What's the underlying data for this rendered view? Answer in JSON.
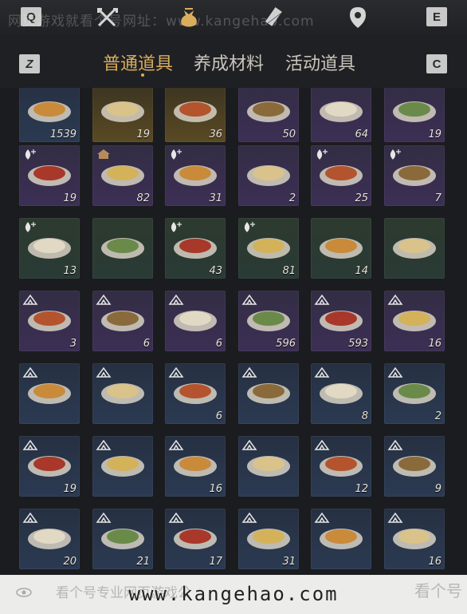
{
  "topbar": {
    "left_key": "Q",
    "right_key": "E",
    "watermark": "网页游戏就看个号网址：www.kangehao.com",
    "icons": [
      "crossed-swords-icon",
      "money-bag-icon",
      "scroll-icon",
      "location-pin-icon"
    ]
  },
  "tabs": {
    "left_key": "Z",
    "right_key": "C",
    "items": [
      "普通道具",
      "养成材料",
      "活动道具"
    ],
    "active_index": 0
  },
  "items": [
    {
      "count": "1539",
      "bg": "navy",
      "icon": "jade-tablet-icon",
      "badge": ""
    },
    {
      "count": "19",
      "bg": "gold",
      "icon": "censer-icon",
      "badge": ""
    },
    {
      "count": "36",
      "bg": "gold",
      "icon": "gold-ingot-icon",
      "badge": ""
    },
    {
      "count": "50",
      "bg": "purple",
      "icon": "jade-stone-icon",
      "badge": ""
    },
    {
      "count": "64",
      "bg": "purple",
      "icon": "steamed-buns-icon",
      "badge": ""
    },
    {
      "count": "19",
      "bg": "purple",
      "icon": "porridge-bowl-icon",
      "badge": ""
    },
    {
      "count": "19",
      "bg": "purple",
      "icon": "egg-soup-icon",
      "badge": "drop-plus-icon"
    },
    {
      "count": "82",
      "bg": "purple",
      "icon": "stir-fry-icon",
      "badge": "house-icon"
    },
    {
      "count": "31",
      "bg": "purple",
      "icon": "fish-plate-icon",
      "badge": "drop-plus-icon"
    },
    {
      "count": "2",
      "bg": "purple",
      "icon": "wine-jar-icon",
      "badge": ""
    },
    {
      "count": "25",
      "bg": "purple",
      "icon": "egg-plate-icon",
      "badge": "drop-plus-icon"
    },
    {
      "count": "7",
      "bg": "purple",
      "icon": "meat-plate-icon",
      "badge": "drop-plus-icon"
    },
    {
      "count": "13",
      "bg": "green",
      "icon": "okra-plate-icon",
      "badge": "drop-plus-icon"
    },
    {
      "count": "",
      "bg": "green",
      "icon": "ribs-icon",
      "badge": ""
    },
    {
      "count": "43",
      "bg": "green",
      "icon": "mushroom-bowl-icon",
      "badge": "drop-plus-icon"
    },
    {
      "count": "81",
      "bg": "green",
      "icon": "stew-pot-icon",
      "badge": "drop-plus-icon"
    },
    {
      "count": "14",
      "bg": "green",
      "icon": "braised-bowl-icon",
      "badge": ""
    },
    {
      "count": "",
      "bg": "green",
      "icon": "meatball-plate-icon",
      "badge": ""
    },
    {
      "count": "3",
      "bg": "purple",
      "icon": "braised-meat-icon",
      "badge": "tent-icon"
    },
    {
      "count": "6",
      "bg": "purple",
      "icon": "fried-rice-icon",
      "badge": "tent-icon"
    },
    {
      "count": "6",
      "bg": "purple",
      "icon": "roast-leg-icon",
      "badge": "tent-icon"
    },
    {
      "count": "596",
      "bg": "purple",
      "icon": "stew-bowl-icon",
      "badge": "tent-icon"
    },
    {
      "count": "593",
      "bg": "purple",
      "icon": "bun-basket-icon",
      "badge": "tent-icon"
    },
    {
      "count": "16",
      "bg": "purple",
      "icon": "grilled-meat-icon",
      "badge": "tent-icon"
    },
    {
      "count": "",
      "bg": "navy",
      "icon": "sliced-pork-icon",
      "badge": "tent-icon"
    },
    {
      "count": "",
      "bg": "navy",
      "icon": "dumplings-icon",
      "badge": "tent-icon"
    },
    {
      "count": "6",
      "bg": "navy",
      "icon": "cake-icon",
      "badge": "tent-icon"
    },
    {
      "count": "",
      "bg": "navy",
      "icon": "pancake-icon",
      "badge": "tent-icon"
    },
    {
      "count": "8",
      "bg": "navy",
      "icon": "veg-soup-icon",
      "badge": "tent-icon"
    },
    {
      "count": "2",
      "bg": "navy",
      "icon": "greens-bowl-icon",
      "badge": "tent-icon"
    },
    {
      "count": "19",
      "bg": "navy",
      "icon": "noodle-bowl-icon",
      "badge": "tent-icon"
    },
    {
      "count": "",
      "bg": "navy",
      "icon": "rice-noodle-icon",
      "badge": "tent-icon"
    },
    {
      "count": "16",
      "bg": "navy",
      "icon": "congee-icon",
      "badge": "tent-icon"
    },
    {
      "count": "",
      "bg": "navy",
      "icon": "red-soup-icon",
      "badge": "tent-icon"
    },
    {
      "count": "12",
      "bg": "navy",
      "icon": "meat-soup-icon",
      "badge": "tent-icon"
    },
    {
      "count": "9",
      "bg": "navy",
      "icon": "tofu-soup-icon",
      "badge": "tent-icon"
    },
    {
      "count": "20",
      "bg": "navy",
      "icon": "broth-bowl-icon",
      "badge": "tent-icon"
    },
    {
      "count": "21",
      "bg": "navy",
      "icon": "porcelain-vase-icon",
      "badge": "tent-icon"
    },
    {
      "count": "17",
      "bg": "navy",
      "icon": "green-gourd-icon",
      "badge": "tent-icon"
    },
    {
      "count": "31",
      "bg": "navy",
      "icon": "noodle-plate-icon",
      "badge": "tent-icon"
    },
    {
      "count": "",
      "bg": "navy",
      "icon": "custard-bowl-icon",
      "badge": "tent-icon"
    },
    {
      "count": "16",
      "bg": "navy",
      "icon": "braised-cubes-icon",
      "badge": "tent-icon"
    }
  ],
  "bottom": {
    "url": "www.kangehao.com",
    "watermark": "看个号专业网页游戏公",
    "logo": "看个号"
  }
}
